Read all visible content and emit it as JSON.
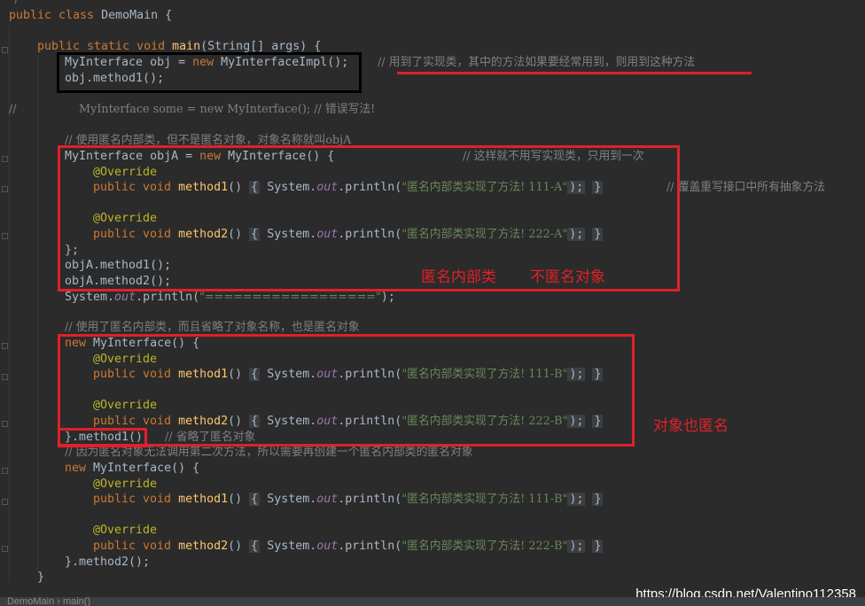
{
  "code": {
    "l0": "*/",
    "l1_kw": "public class",
    "l1_name": "DemoMain {",
    "l2_kw": "public static void",
    "l2_fn": "main",
    "l2_rest": "(String[] args) {",
    "l3_pre": "MyInterface obj = ",
    "l3_kw": "new",
    "l3_rest": " MyInterfaceImpl();",
    "l3_comment": "// 用到了实现类，其中的方法如果要经常用到，则用到这种方法",
    "l4": "obj.method1();",
    "l5_pre": "//",
    "l5_rest": "MyInterface some = new MyInterface(); // 错误写法!",
    "l6_comment": "// 使用匿名内部类，但不是匿名对象，对象名称就叫objA",
    "l7_pre": "MyInterface objA = ",
    "l7_kw": "new",
    "l7_rest": " MyInterface() {",
    "l7_comment": "// 这样就不用写实现类，只用到一次",
    "override": "@Override",
    "pub_void": "public void",
    "method1": "method1",
    "method2": "method2",
    "paren": "()",
    "sys": "System.",
    "out": "out",
    "println": ".println(",
    "str_111a": "\"匿名内部类实现了方法! 111-A\"",
    "str_222a": "\"匿名内部类实现了方法! 222-A\"",
    "str_111b": "\"匿名内部类实现了方法! 111-B\"",
    "str_222b": "\"匿名内部类实现了方法! 222-B\"",
    "close_call": ");",
    "brace_open": "{",
    "brace_close": "}",
    "l9_comment": "// 覆盖重写接口中所有抽象方法",
    "l12": "};",
    "l13": "objA.method1();",
    "l14": "objA.method2();",
    "l15_pre": "System.",
    "l15_out": "out",
    "l15_rest": ".println(",
    "l15_str": "\"==================\"",
    "l15_end": ");",
    "l16_comment": "// 使用了匿名内部类，而且省略了对象名称，也是匿名对象",
    "l17_kw": "new",
    "l17_rest": " MyInterface() {",
    "l22_a": "}.method1()",
    "l22_comment": "// 省略了匿名对象",
    "l23_comment": "// 因为匿名对象无法调用第二次方法，所以需要再创建一个匿名内部类的匿名对象",
    "l29": "}.method2();",
    "l30": "}"
  },
  "annotations": {
    "note1": "匿名内部类",
    "note2": "不匿名对象",
    "note3": "对象也匿名"
  },
  "watermark": "https://blog.csdn.net/Valentino112358",
  "breadcrumb": "DemoMain  ›  main()",
  "colors": {
    "background": "#2b2b2b",
    "keyword": "#cc7832",
    "function": "#ffc66d",
    "annotation": "#bbb529",
    "string": "#6a8759",
    "static_field": "#9876aa",
    "comment": "#808080",
    "highlight_red": "#e0202a"
  }
}
